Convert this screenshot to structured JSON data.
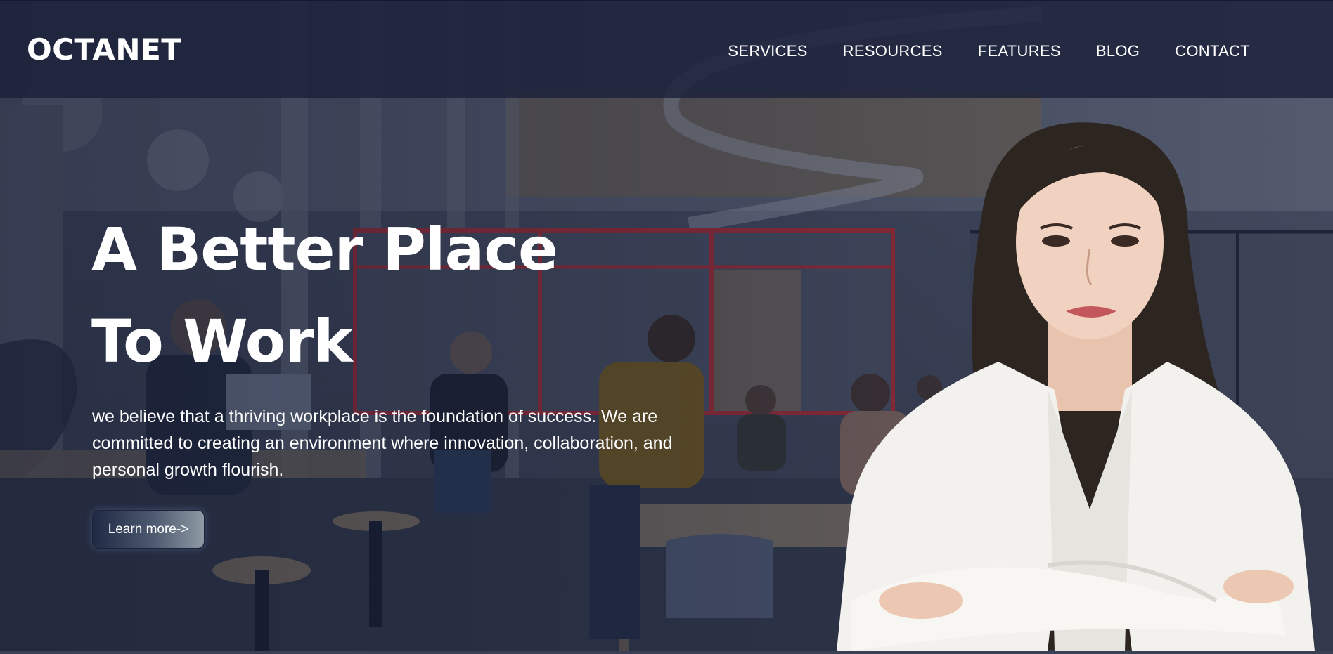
{
  "brand": {
    "logo": "OCTANET"
  },
  "nav": {
    "items": [
      {
        "label": "SERVICES"
      },
      {
        "label": "RESOURCES"
      },
      {
        "label": "FEATURES"
      },
      {
        "label": "BLOG"
      },
      {
        "label": "CONTACT"
      }
    ]
  },
  "hero": {
    "title_line1": "A Better Place",
    "title_line2": "To Work",
    "description": "we believe that a thriving workplace is the foundation of success. We are committed to creating an environment where innovation, collaboration, and personal growth flourish.",
    "cta_label": "Learn more->"
  },
  "images": {
    "background": "office-interior-photo",
    "portrait": "woman-in-white-blazer-photo"
  },
  "colors": {
    "navbar_bg": "#1c213a",
    "text": "#ffffff",
    "accent_red": "#c8323a",
    "cta_gradient_start": "#1f2a44",
    "cta_gradient_end": "#8e9aa4"
  }
}
